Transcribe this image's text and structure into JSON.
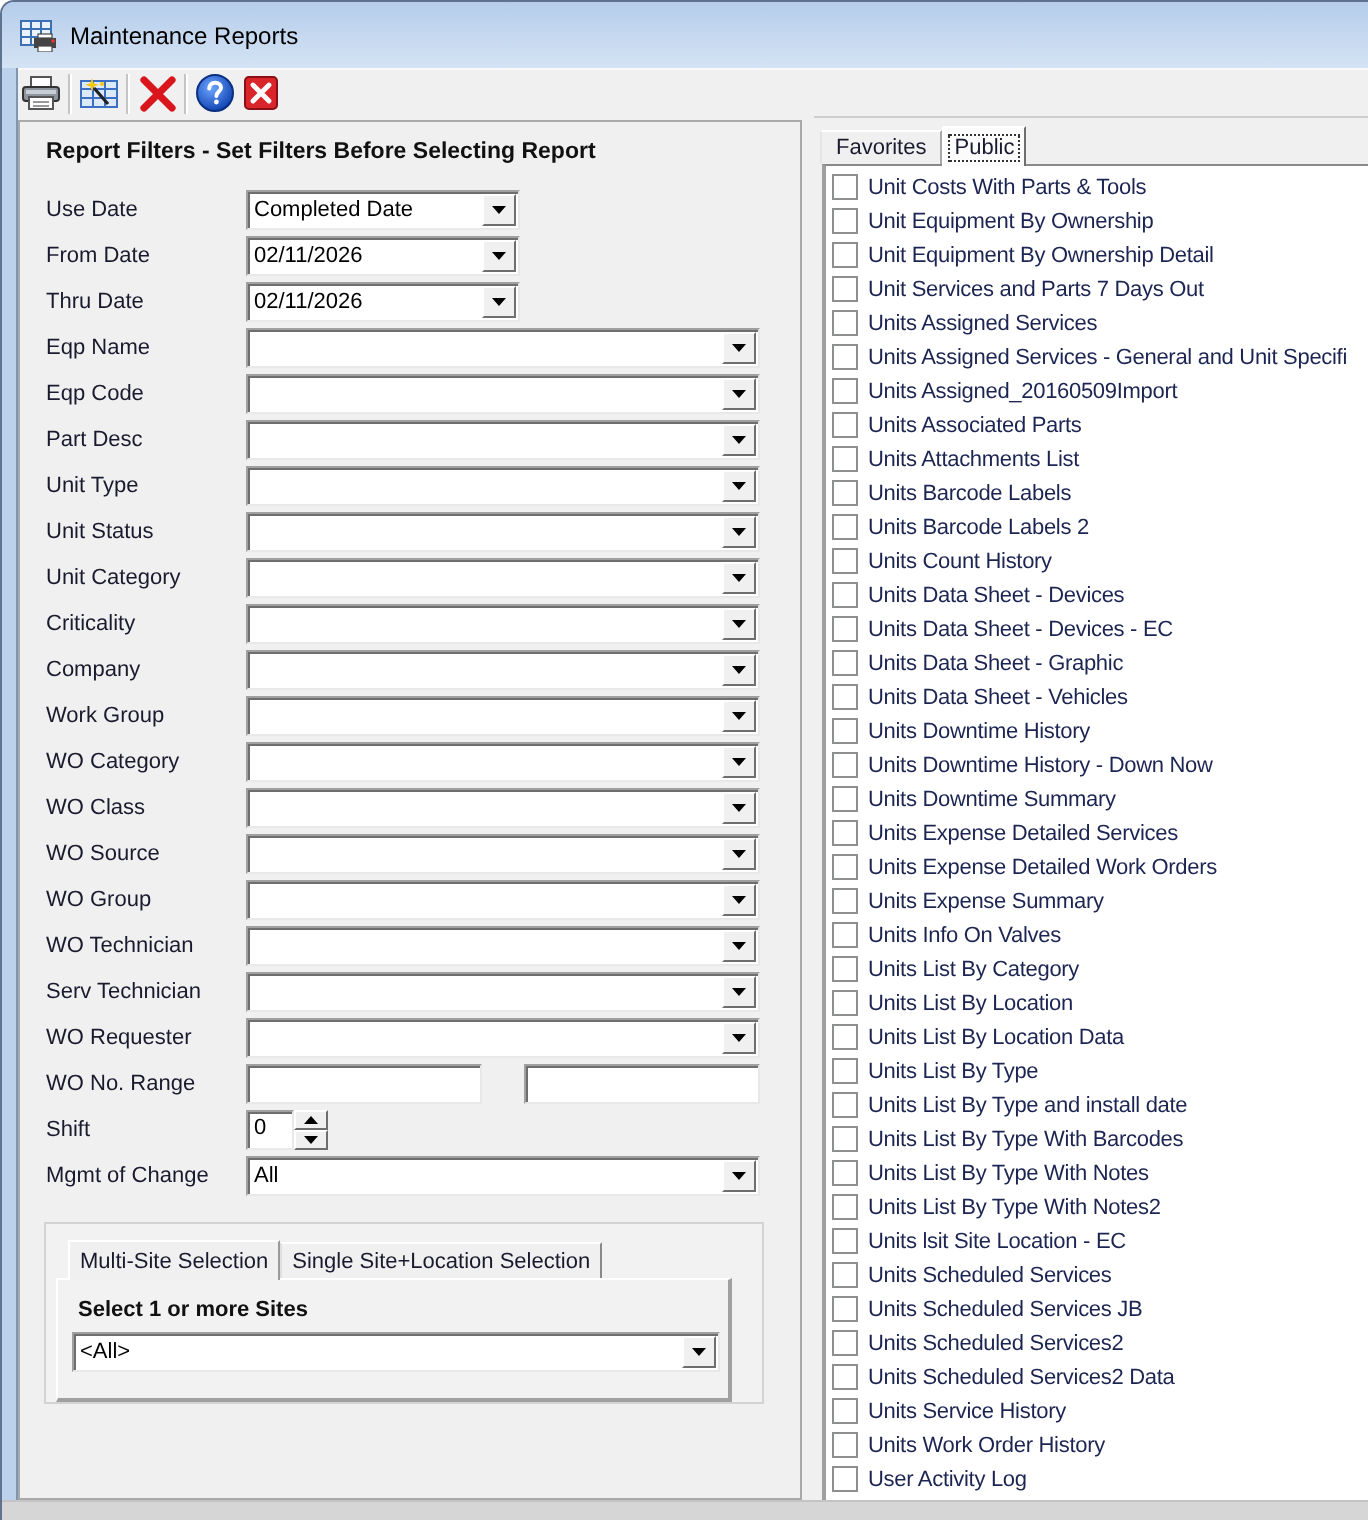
{
  "window": {
    "title": "Maintenance Reports"
  },
  "filters": {
    "title": "Report Filters - Set Filters Before Selecting Report",
    "fields": [
      {
        "label": "Use Date",
        "kind": "choice",
        "value": "Completed Date"
      },
      {
        "label": "From Date",
        "kind": "date",
        "value": "02/11/2026"
      },
      {
        "label": "Thru Date",
        "kind": "date",
        "value": "02/11/2026"
      },
      {
        "label": "Eqp Name",
        "kind": "combo"
      },
      {
        "label": "Eqp Code",
        "kind": "combo"
      },
      {
        "label": "Part Desc",
        "kind": "combo"
      },
      {
        "label": "Unit Type",
        "kind": "combo"
      },
      {
        "label": "Unit Status",
        "kind": "combo"
      },
      {
        "label": "Unit Category",
        "kind": "combo"
      },
      {
        "label": "Criticality",
        "kind": "combo"
      },
      {
        "label": "Company",
        "kind": "combo"
      },
      {
        "label": "Work Group",
        "kind": "combo"
      },
      {
        "label": "WO Category",
        "kind": "combo"
      },
      {
        "label": "WO Class",
        "kind": "combo"
      },
      {
        "label": "WO Source",
        "kind": "combo"
      },
      {
        "label": "WO Group",
        "kind": "combo"
      },
      {
        "label": "WO Technician",
        "kind": "combo"
      },
      {
        "label": "Serv Technician",
        "kind": "combo"
      },
      {
        "label": "WO Requester",
        "kind": "combo"
      },
      {
        "label": "WO No. Range",
        "kind": "range"
      },
      {
        "label": "Shift",
        "kind": "spinner",
        "value": "0"
      },
      {
        "label": "Mgmt of Change",
        "kind": "combo",
        "value": "All"
      }
    ]
  },
  "site_selection": {
    "tabs": [
      {
        "label": "Multi-Site Selection",
        "selected": true
      },
      {
        "label": "Single Site+Location Selection",
        "selected": false
      }
    ],
    "heading": "Select 1 or more Sites",
    "value": "<All>"
  },
  "reports": {
    "tabs": [
      {
        "label": "Favorites",
        "selected": false
      },
      {
        "label": "Public",
        "selected": true
      }
    ],
    "items": [
      {
        "label": "Unit Costs With Parts & Tools",
        "checked": false
      },
      {
        "label": "Unit Equipment By Ownership",
        "checked": false
      },
      {
        "label": "Unit Equipment By Ownership Detail",
        "checked": false
      },
      {
        "label": "Unit Services and Parts 7 Days Out",
        "checked": false
      },
      {
        "label": "Units Assigned Services",
        "checked": false
      },
      {
        "label": "Units Assigned Services - General and Unit Specifi",
        "checked": false
      },
      {
        "label": "Units Assigned_20160509Import",
        "checked": false
      },
      {
        "label": "Units Associated Parts",
        "checked": false
      },
      {
        "label": "Units Attachments List",
        "checked": false
      },
      {
        "label": "Units Barcode Labels",
        "checked": false
      },
      {
        "label": "Units Barcode Labels 2",
        "checked": false
      },
      {
        "label": "Units Count History",
        "checked": false
      },
      {
        "label": "Units Data Sheet - Devices",
        "checked": false
      },
      {
        "label": "Units Data Sheet - Devices - EC",
        "checked": false
      },
      {
        "label": "Units Data Sheet - Graphic",
        "checked": false
      },
      {
        "label": "Units Data Sheet - Vehicles",
        "checked": false
      },
      {
        "label": "Units Downtime History",
        "checked": false
      },
      {
        "label": "Units Downtime History - Down Now",
        "checked": false
      },
      {
        "label": "Units Downtime Summary",
        "checked": false
      },
      {
        "label": "Units Expense Detailed Services",
        "checked": false
      },
      {
        "label": "Units Expense Detailed Work Orders",
        "checked": false
      },
      {
        "label": "Units Expense Summary",
        "checked": false
      },
      {
        "label": "Units Info On Valves",
        "checked": false
      },
      {
        "label": "Units List By Category",
        "checked": false
      },
      {
        "label": "Units List By Location",
        "checked": false
      },
      {
        "label": "Units List By Location Data",
        "checked": false
      },
      {
        "label": "Units List By Type",
        "checked": false
      },
      {
        "label": "Units List By Type and install date",
        "checked": false
      },
      {
        "label": "Units List By Type With Barcodes",
        "checked": false
      },
      {
        "label": "Units List By Type With Notes",
        "checked": false
      },
      {
        "label": "Units List By Type With Notes2",
        "checked": false
      },
      {
        "label": "Units lsit Site Location - EC",
        "checked": false
      },
      {
        "label": "Units Scheduled Services",
        "checked": false
      },
      {
        "label": "Units Scheduled Services JB",
        "checked": false
      },
      {
        "label": "Units Scheduled Services2",
        "checked": false
      },
      {
        "label": "Units Scheduled Services2 Data",
        "checked": false
      },
      {
        "label": "Units Service History",
        "checked": false
      },
      {
        "label": "Units Work Order History",
        "checked": false
      },
      {
        "label": "User Activity Log",
        "checked": false
      }
    ]
  }
}
